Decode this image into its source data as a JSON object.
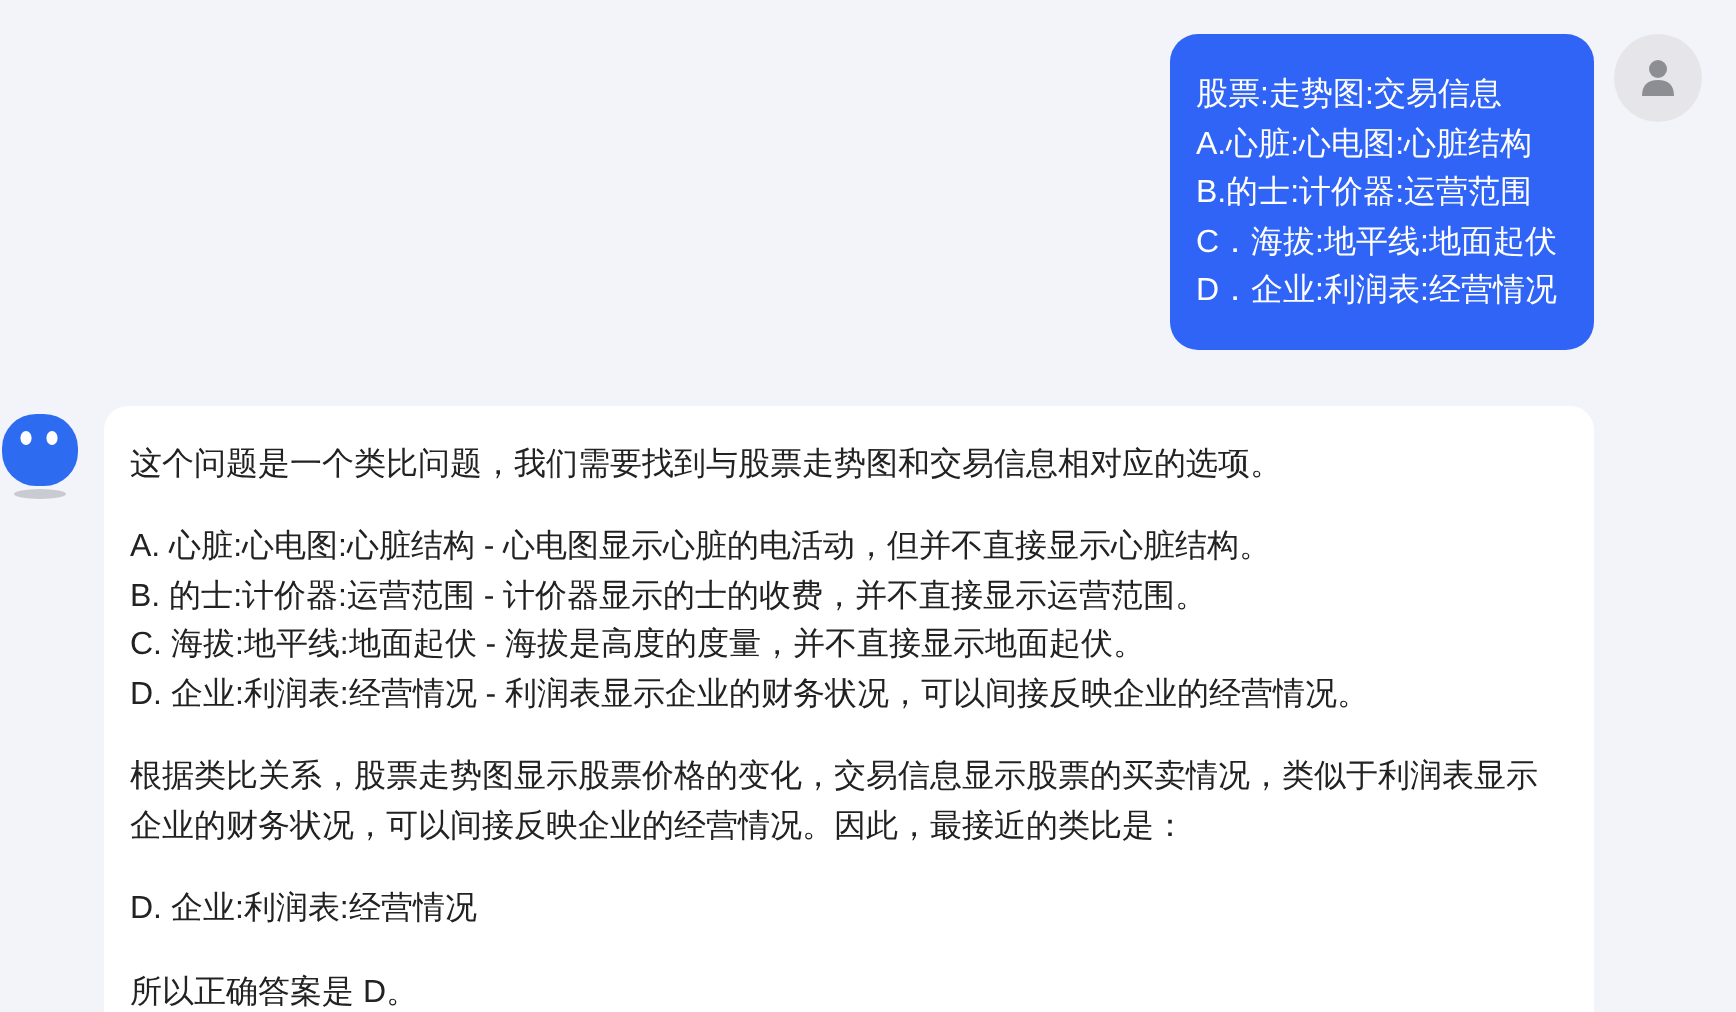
{
  "user_message": {
    "lines": [
      "股票:走势图:交易信息",
      "A.心脏:心电图:心脏结构",
      "B.的士:计价器:运营范围",
      "C．海拔:地平线:地面起伏",
      "D．企业:利润表:经营情况"
    ]
  },
  "bot_message": {
    "paragraphs": [
      {
        "lines": [
          "这个问题是一个类比问题，我们需要找到与股票走势图和交易信息相对应的选项。"
        ]
      },
      {
        "lines": [
          "A. 心脏:心电图:心脏结构 - 心电图显示心脏的电活动，但并不直接显示心脏结构。",
          "B. 的士:计价器:运营范围 - 计价器显示的士的收费，并不直接显示运营范围。",
          "C. 海拔:地平线:地面起伏 - 海拔是高度的度量，并不直接显示地面起伏。",
          "D. 企业:利润表:经营情况 - 利润表显示企业的财务状况，可以间接反映企业的经营情况。"
        ]
      },
      {
        "lines": [
          "根据类比关系，股票走势图显示股票价格的变化，交易信息显示股票的买卖情况，类似于利润表显示企业的财务状况，可以间接反映企业的经营情况。因此，最接近的类比是："
        ]
      },
      {
        "lines": [
          "D. 企业:利润表:经营情况"
        ]
      },
      {
        "lines": [
          "所以正确答案是 D。"
        ]
      }
    ]
  }
}
